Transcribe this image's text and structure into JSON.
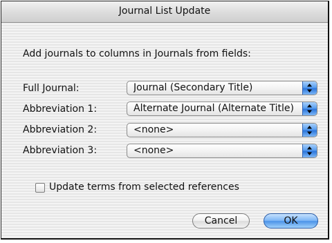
{
  "dialog": {
    "title": "Journal List Update",
    "prompt": "Add journals to columns in Journals from fields:"
  },
  "rows": [
    {
      "label": "Full Journal:",
      "value": "Journal (Secondary Title)"
    },
    {
      "label": "Abbreviation 1:",
      "value": "Alternate Journal (Alternate Title)"
    },
    {
      "label": "Abbreviation 2:",
      "value": "<none>"
    },
    {
      "label": "Abbreviation 3:",
      "value": "<none>"
    }
  ],
  "checkbox": {
    "label": "Update terms from selected references",
    "checked": false
  },
  "buttons": {
    "cancel": "Cancel",
    "ok": "OK"
  },
  "colors": {
    "default_button": "#4b93e8",
    "popup_arrow": "#2d77dc"
  },
  "icons": {
    "popup_arrows": "up-down-arrows-icon"
  }
}
